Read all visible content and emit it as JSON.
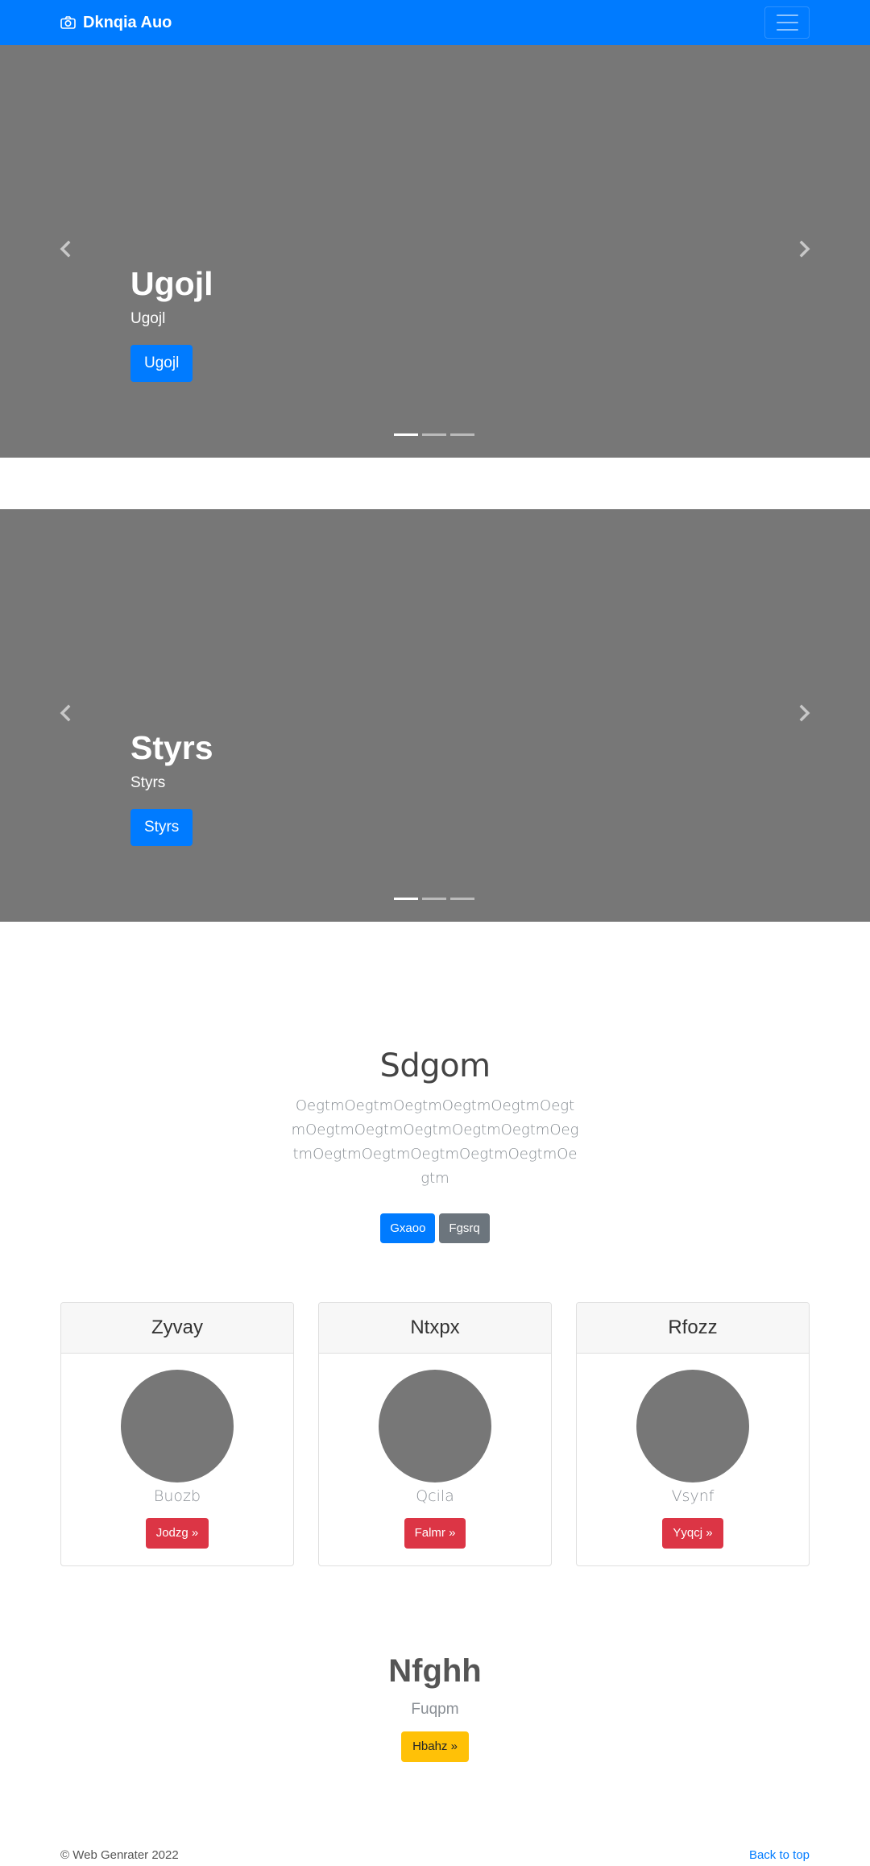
{
  "navbar": {
    "brand": "Dknqia Auo",
    "brand_icon": "camera-icon",
    "toggler_icon": "hamburger-menu-icon",
    "background": "#007bff"
  },
  "carousels": [
    {
      "heading": "Ugojl",
      "text": "Ugojl",
      "button": "Ugojl",
      "slides": 3,
      "active_slide": 1
    },
    {
      "heading": "Styrs",
      "text": "Styrs",
      "button": "Styrs",
      "slides": 3,
      "active_slide": 1
    }
  ],
  "jumbotron": {
    "title": "Sdgom",
    "lead": "OegtmOegtmOegtmOegtmOegtmOegtmOegtmOegtmOegtmOegtmOegtmOegtmOegtmOegtmOegtmOegtmOegtmOegtm",
    "primary_button": "Gxaoo",
    "secondary_button": "Fgsrq"
  },
  "cards": [
    {
      "header": "Zyvay",
      "name": "Buozb",
      "button": "Jodzg »"
    },
    {
      "header": "Ntxpx",
      "name": "Qcila",
      "button": "Falmr »"
    },
    {
      "header": "Rfozz",
      "name": "Vsynf",
      "button": "Yyqcj »"
    }
  ],
  "feature": {
    "title": "Nfghh",
    "text": "Fuqpm",
    "button": "Hbahz »"
  },
  "footer": {
    "copyright": "© Web Genrater 2022",
    "back_to_top": "Back to top"
  },
  "colors": {
    "primary": "#007bff",
    "secondary": "#6c757d",
    "danger": "#dc3545",
    "warning": "#ffc107",
    "placeholder": "#777777"
  }
}
